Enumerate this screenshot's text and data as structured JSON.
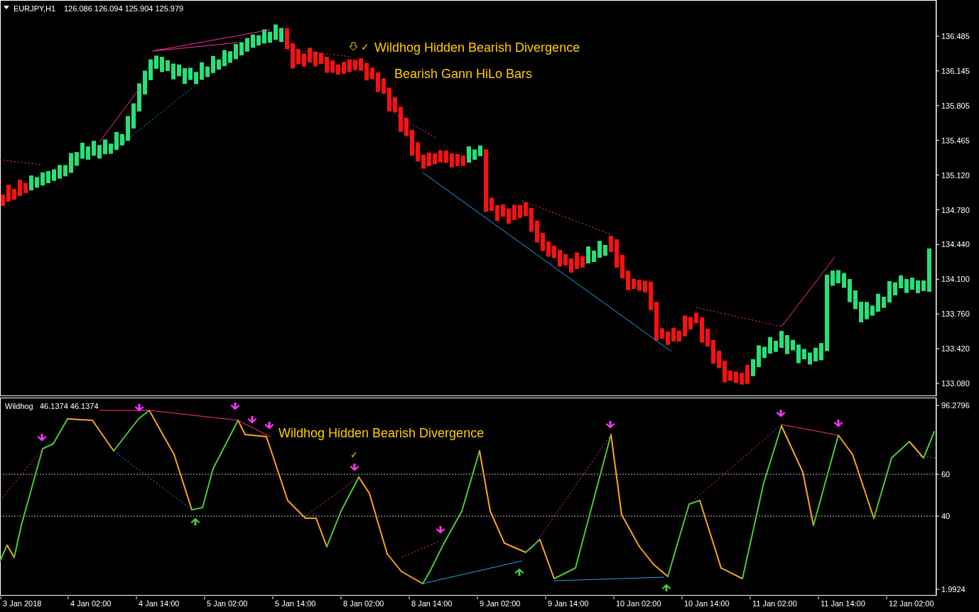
{
  "main_chart": {
    "symbol": "EURJPY,H1",
    "ohlc": "126.086 126.094 125.904 125.979",
    "annotations": [
      {
        "kind": "signal",
        "check": "✓",
        "text": "Wildhog Hidden Bearish Divergence"
      },
      {
        "kind": "label",
        "text": "Bearish Gann HiLo Bars"
      }
    ],
    "price_labels": [
      "136.485",
      "136.145",
      "135.805",
      "135.465",
      "135.120",
      "134.780",
      "134.440",
      "134.100",
      "133.760",
      "133.420",
      "133.080"
    ]
  },
  "indicator": {
    "name": "Wildhog",
    "values": "46.1374 46.1374",
    "check": "✓",
    "annotation": "Wildhog Hidden Bearish Divergence",
    "scale_labels": [
      "96.2796",
      "60",
      "40",
      "1.9924"
    ]
  },
  "time_labels": [
    "3 Jan 2018",
    "4 Jan 02:00",
    "4 Jan 14:00",
    "5 Jan 02:00",
    "5 Jan 14:00",
    "8 Jan 02:00",
    "8 Jan 14:00",
    "9 Jan 02:00",
    "9 Jan 14:00",
    "10 Jan 02:00",
    "10 Jan 14:00",
    "11 Jan 02:00",
    "11 Jan 14:00",
    "12 Jan 02:00"
  ]
}
